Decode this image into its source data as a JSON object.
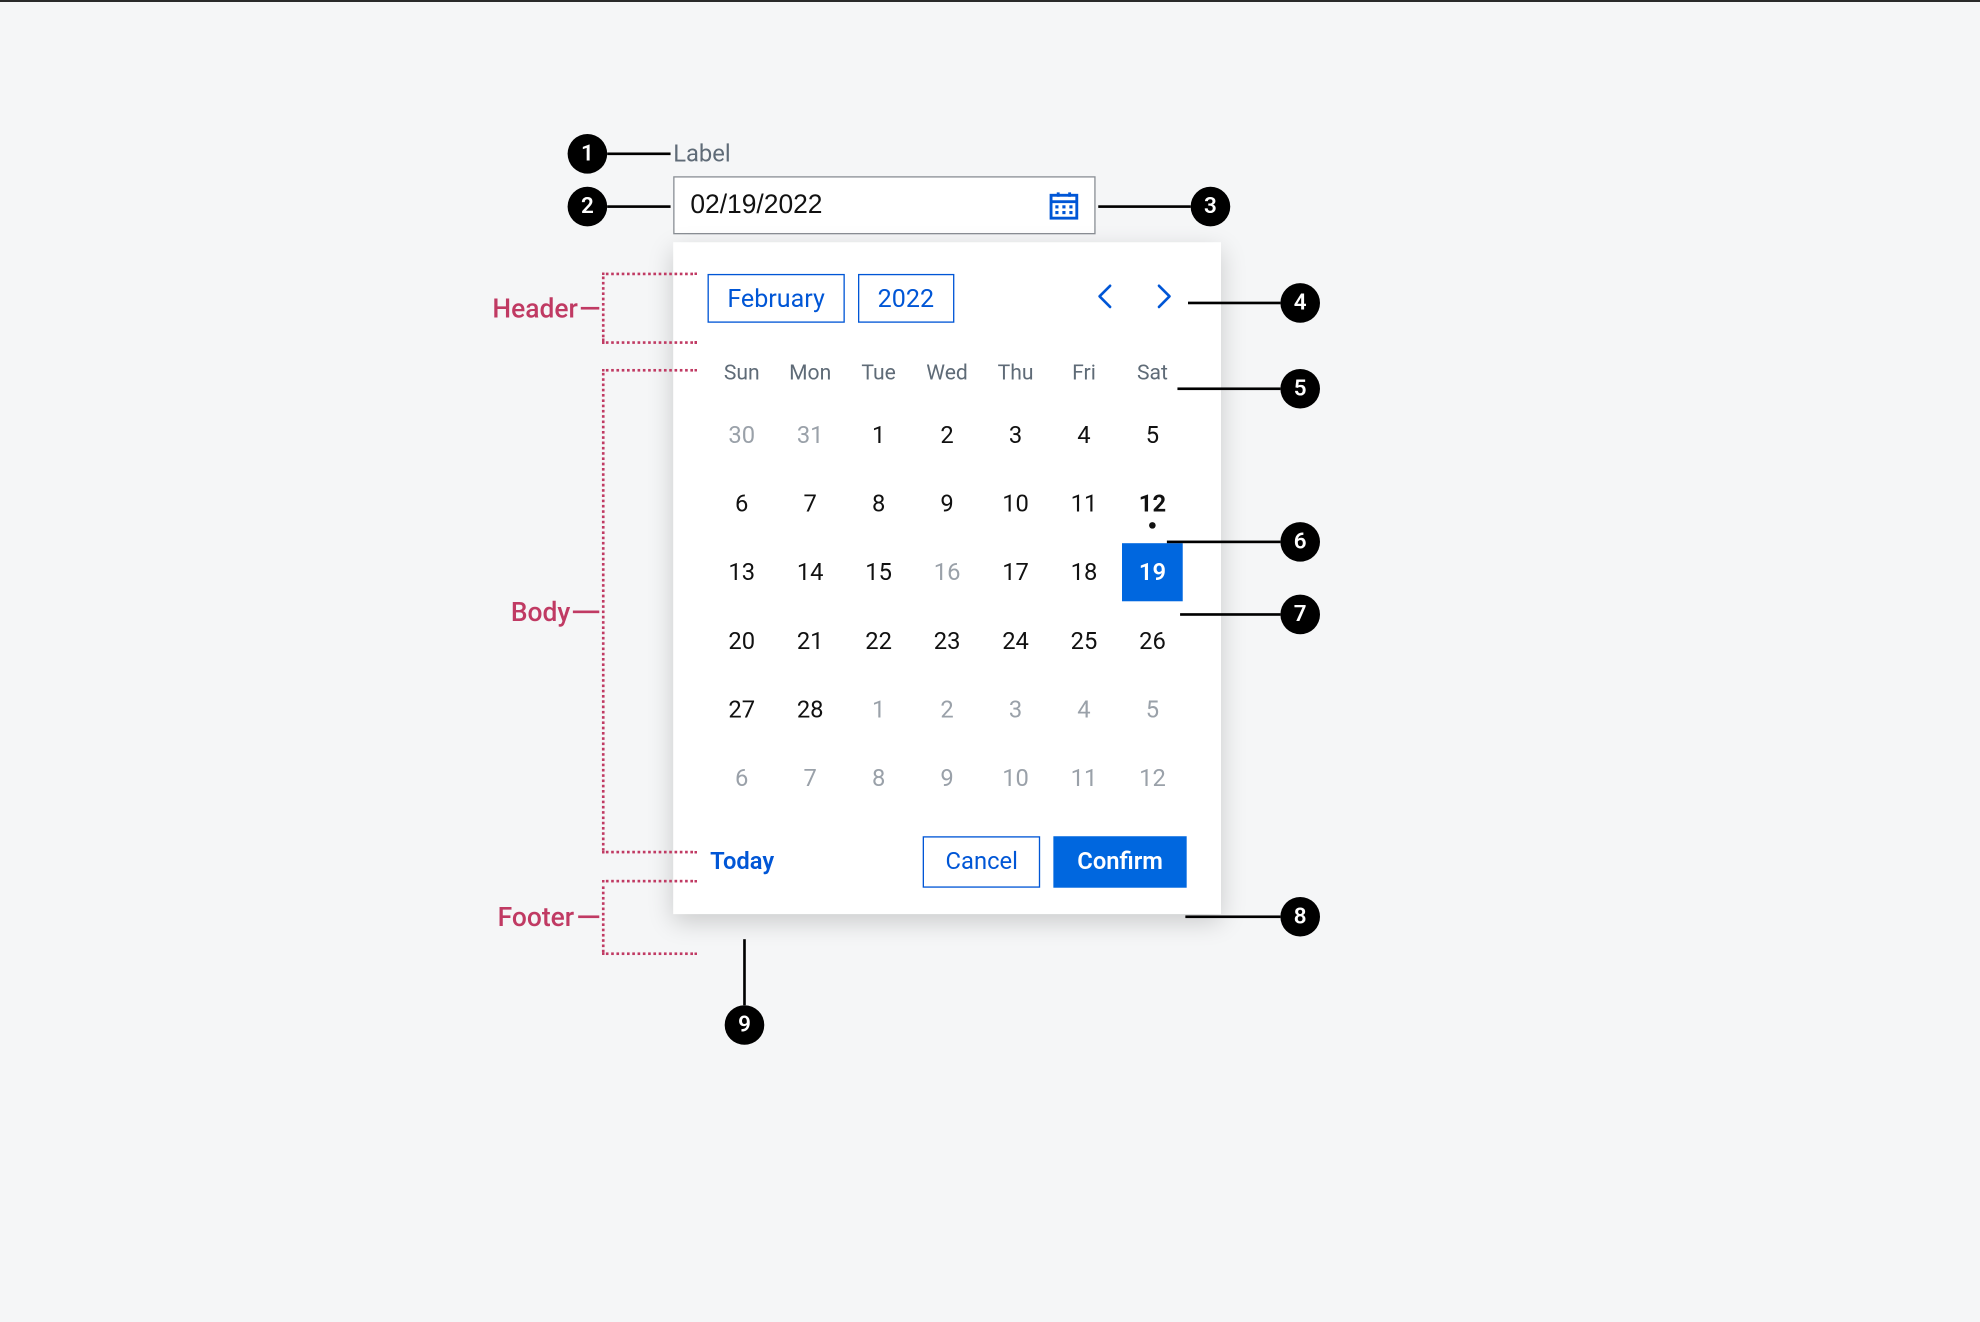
{
  "colors": {
    "accent": "#0067df",
    "accent_border": "#0056d6",
    "annotation": "#c03a63"
  },
  "field": {
    "label": "Label",
    "value": "02/19/2022"
  },
  "header": {
    "month_label": "February",
    "year_label": "2022"
  },
  "daysOfWeek": [
    "Sun",
    "Mon",
    "Tue",
    "Wed",
    "Thu",
    "Fri",
    "Sat"
  ],
  "calendar": {
    "rows": [
      [
        {
          "n": "30",
          "out": true
        },
        {
          "n": "31",
          "out": true
        },
        {
          "n": "1"
        },
        {
          "n": "2"
        },
        {
          "n": "3"
        },
        {
          "n": "4"
        },
        {
          "n": "5"
        }
      ],
      [
        {
          "n": "6"
        },
        {
          "n": "7"
        },
        {
          "n": "8"
        },
        {
          "n": "9"
        },
        {
          "n": "10"
        },
        {
          "n": "11"
        },
        {
          "n": "12",
          "today": true
        }
      ],
      [
        {
          "n": "13"
        },
        {
          "n": "14"
        },
        {
          "n": "15"
        },
        {
          "n": "16",
          "dim": true
        },
        {
          "n": "17"
        },
        {
          "n": "18"
        },
        {
          "n": "19",
          "selected": true
        }
      ],
      [
        {
          "n": "20"
        },
        {
          "n": "21"
        },
        {
          "n": "22"
        },
        {
          "n": "23"
        },
        {
          "n": "24"
        },
        {
          "n": "25"
        },
        {
          "n": "26"
        }
      ],
      [
        {
          "n": "27"
        },
        {
          "n": "28"
        },
        {
          "n": "1",
          "out": true
        },
        {
          "n": "2",
          "out": true
        },
        {
          "n": "3",
          "out": true
        },
        {
          "n": "4",
          "out": true
        },
        {
          "n": "5",
          "out": true
        }
      ],
      [
        {
          "n": "6",
          "out": true
        },
        {
          "n": "7",
          "out": true
        },
        {
          "n": "8",
          "out": true
        },
        {
          "n": "9",
          "out": true
        },
        {
          "n": "10",
          "out": true
        },
        {
          "n": "11",
          "out": true
        },
        {
          "n": "12",
          "out": true
        }
      ]
    ]
  },
  "footer": {
    "today_label": "Today",
    "cancel_label": "Cancel",
    "confirm_label": "Confirm"
  },
  "sections": {
    "header_label": "Header",
    "body_label": "Body",
    "footer_label": "Footer"
  },
  "annotations": {
    "p1": "1",
    "p2": "2",
    "p3": "3",
    "p4": "4",
    "p5": "5",
    "p6": "6",
    "p7": "7",
    "p8": "8",
    "p9": "9"
  }
}
